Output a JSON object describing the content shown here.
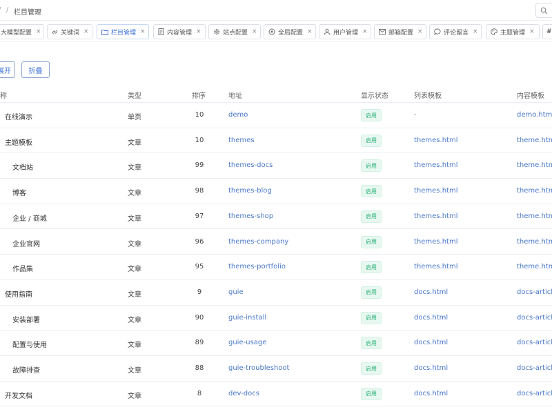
{
  "breadcrumb": {
    "separator": "/",
    "current": "栏目管理"
  },
  "tabs": [
    {
      "label": "大模型配置",
      "icon": "none",
      "active": false
    },
    {
      "label": "关键词",
      "icon": "link-icon",
      "active": false
    },
    {
      "label": "栏目管理",
      "icon": "folder-icon",
      "active": true
    },
    {
      "label": "内容管理",
      "icon": "document-icon",
      "active": false
    },
    {
      "label": "站点配置",
      "icon": "gear-icon",
      "active": false
    },
    {
      "label": "全局配置",
      "icon": "settings-icon",
      "active": false
    },
    {
      "label": "用户管理",
      "icon": "user-icon",
      "active": false
    },
    {
      "label": "邮箱配置",
      "icon": "mail-icon",
      "active": false
    },
    {
      "label": "评论留言",
      "icon": "comment-icon",
      "active": false
    },
    {
      "label": "主题管理",
      "icon": "palette-icon",
      "active": false
    }
  ],
  "tab_close": "×",
  "tab_overflow": "#",
  "actions": {
    "expand": "展开",
    "collapse": "折叠"
  },
  "table": {
    "headers": {
      "name": "名称",
      "type": "类型",
      "sort": "排序",
      "address": "地址",
      "status": "显示状态",
      "list_template": "列表模板",
      "content_template": "内容模板"
    },
    "rows": [
      {
        "name": "在线演示",
        "type": "单页",
        "sort": "10",
        "address": "demo",
        "status": "启用",
        "list_template": "-",
        "content_template": "demo.html"
      },
      {
        "name": "主题模板",
        "type": "文章",
        "sort": "10",
        "address": "themes",
        "status": "启用",
        "list_template": "themes.html",
        "content_template": "theme.html"
      },
      {
        "name": "文档站",
        "type": "文章",
        "sort": "99",
        "address": "themes-docs",
        "status": "启用",
        "list_template": "themes.html",
        "content_template": "theme.html"
      },
      {
        "name": "博客",
        "type": "文章",
        "sort": "98",
        "address": "themes-blog",
        "status": "启用",
        "list_template": "themes.html",
        "content_template": "theme.html"
      },
      {
        "name": "企业 / 商城",
        "type": "文章",
        "sort": "97",
        "address": "themes-shop",
        "status": "启用",
        "list_template": "themes.html",
        "content_template": "theme.html"
      },
      {
        "name": "企业官网",
        "type": "文章",
        "sort": "96",
        "address": "themes-company",
        "status": "启用",
        "list_template": "themes.html",
        "content_template": "theme.html"
      },
      {
        "name": "作品集",
        "type": "文章",
        "sort": "95",
        "address": "themes-portfolio",
        "status": "启用",
        "list_template": "themes.html",
        "content_template": "theme.html"
      },
      {
        "name": "使用指南",
        "type": "文章",
        "sort": "9",
        "address": "guie",
        "status": "启用",
        "list_template": "docs.html",
        "content_template": "docs-article.html"
      },
      {
        "name": "安装部署",
        "type": "文章",
        "sort": "90",
        "address": "guie-install",
        "status": "启用",
        "list_template": "docs.html",
        "content_template": "docs-article.html"
      },
      {
        "name": "配置与使用",
        "type": "文章",
        "sort": "89",
        "address": "guie-usage",
        "status": "启用",
        "list_template": "docs.html",
        "content_template": "docs-article.html"
      },
      {
        "name": "故障排查",
        "type": "文章",
        "sort": "88",
        "address": "guie-troubleshoot",
        "status": "启用",
        "list_template": "docs.html",
        "content_template": "docs-article.html"
      },
      {
        "name": "开发文档",
        "type": "文章",
        "sort": "8",
        "address": "dev-docs",
        "status": "启用",
        "list_template": "docs.html",
        "content_template": "docs-article.html"
      }
    ]
  },
  "colors": {
    "accent": "#3a6fd8",
    "link": "#4a78c8",
    "status_bg": "#e8f8f1",
    "status_text": "#2eb37a"
  }
}
